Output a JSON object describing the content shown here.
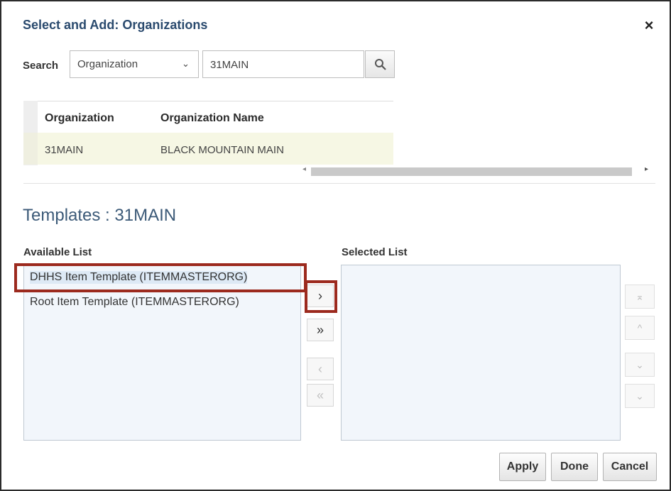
{
  "dialog": {
    "title": "Select and Add: Organizations",
    "close_icon": "×"
  },
  "search": {
    "label": "Search",
    "field_value": "Organization",
    "query": "31MAIN"
  },
  "table": {
    "headers": [
      "Organization",
      "Organization Name"
    ],
    "rows": [
      {
        "organization": "31MAIN",
        "organization_name": "BLACK MOUNTAIN MAIN"
      }
    ]
  },
  "templates": {
    "heading": "Templates : 31MAIN",
    "available_label": "Available List",
    "selected_label": "Selected List",
    "available": [
      "DHHS Item Template (ITEMMASTERORG)",
      "Root Item Template (ITEMMASTERORG)"
    ],
    "selected": []
  },
  "shuttle": {
    "move": "›",
    "move_all": "»",
    "remove": "‹",
    "remove_all": "«"
  },
  "reorder": {
    "top": "⌅",
    "up": "^",
    "down": "⌄",
    "bottom": "⌄"
  },
  "footer": {
    "apply": "Apply",
    "done": "Done",
    "cancel": "Cancel"
  },
  "colors": {
    "highlight_border": "#9c2a1e",
    "row_selected": "#f6f7e4",
    "list_bg": "#f2f6fb",
    "title": "#2a4a6e"
  }
}
